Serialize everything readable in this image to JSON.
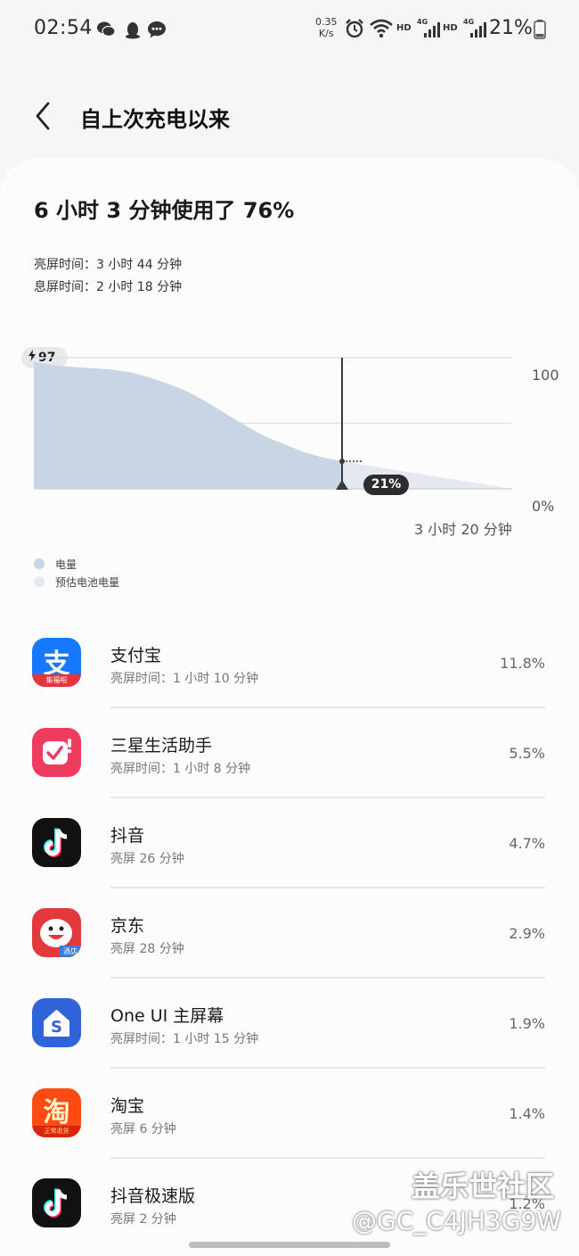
{
  "status_bar": {
    "time": "02:54",
    "net_speed_value": "0.35",
    "net_speed_unit": "K/s",
    "hd1": "HD",
    "hd2": "HD",
    "sig1": "4G",
    "sig2": "4G",
    "battery": "21%"
  },
  "header": {
    "title": "自上次充电以来"
  },
  "summary": {
    "title": "6 小时 3 分钟使用了 76%",
    "screen_on": "亮屏时间：3 小时 44 分钟",
    "screen_off": "息屏时间：2 小时 18 分钟"
  },
  "chart": {
    "charge_start_label": "97",
    "y_max_label": "100",
    "y_min_label": "0%",
    "remaining_label": "3 小时 20 分钟",
    "current_label": "21%",
    "legend_actual": "电量",
    "legend_estimated": "预估电池电量",
    "colors": {
      "actual": "#c8d5e4",
      "estimated": "#e4e9f0",
      "marker": "#3a3a3c"
    }
  },
  "chart_data": {
    "type": "area",
    "series": [
      {
        "name": "电量",
        "values": [
          97,
          94,
          93,
          92,
          91,
          89,
          85,
          80,
          74,
          66,
          57,
          48,
          40,
          34,
          28,
          24,
          21
        ]
      },
      {
        "name": "预估电池电量",
        "values": [
          21,
          0
        ]
      }
    ],
    "ylim": [
      0,
      100
    ]
  },
  "apps": [
    {
      "name": "支付宝",
      "sub": "亮屏时间：1 小时 10 分钟",
      "pct": "11.8%",
      "icon": "alipay-icon",
      "badge": "集福啦",
      "glyph": "支"
    },
    {
      "name": "三星生活助手",
      "sub": "亮屏时间：1 小时 8 分钟",
      "pct": "5.5%",
      "icon": "samsung-life-helper-icon"
    },
    {
      "name": "抖音",
      "sub": "亮屏 26 分钟",
      "pct": "4.7%",
      "icon": "douyin-icon"
    },
    {
      "name": "京东",
      "sub": "亮屏 28 分钟",
      "pct": "2.9%",
      "icon": "jd-icon",
      "badge": "酒店"
    },
    {
      "name": "One UI 主屏幕",
      "sub": "亮屏时间：1 小时 15 分钟",
      "pct": "1.9%",
      "icon": "oneui-home-icon",
      "glyph": "S"
    },
    {
      "name": "淘宝",
      "sub": "亮屏 6 分钟",
      "pct": "1.4%",
      "icon": "taobao-icon",
      "glyph": "淘",
      "badge": "正常退货"
    },
    {
      "name": "抖音极速版",
      "sub": "亮屏 2 分钟",
      "pct": "1.2%",
      "icon": "douyin-lite-icon"
    }
  ],
  "watermark": {
    "line1": "盖乐世社区",
    "line2": "@GC_C4JH3G9W"
  }
}
